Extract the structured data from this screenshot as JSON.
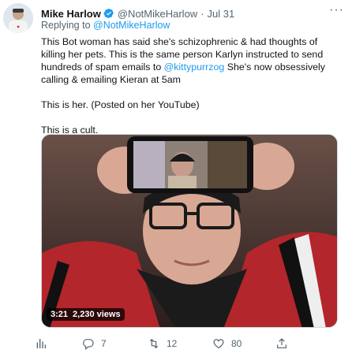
{
  "author": {
    "name": "Mike Harlow",
    "handle": "@NotMikeHarlow",
    "separator": "·",
    "time": "Jul 31",
    "verified": true
  },
  "more_label": "···",
  "reply": {
    "prefix": "Replying to ",
    "to": "@NotMikeHarlow"
  },
  "body": {
    "p1_part1": "This Bot woman has said she's schizophrenic & had thoughts of killing her pets. This is the same person Karlyn instructed to send hundreds of spam emails to ",
    "p1_mention": "@kittypurrzog",
    "p1_part2": " She's now obsessively calling & emailing Kieran at 5am",
    "p2": "This is her. (Posted on her YouTube)",
    "p3": "This is a cult."
  },
  "media": {
    "duration": "3:21",
    "views": "2,230 views"
  },
  "actions": {
    "analytics_icon": "bar-chart-icon",
    "replies": "7",
    "retweets": "12",
    "likes": "80",
    "share_icon": "share-icon"
  },
  "colors": {
    "accent": "#1d9bf0",
    "muted": "#536471",
    "text": "#0f1419"
  }
}
